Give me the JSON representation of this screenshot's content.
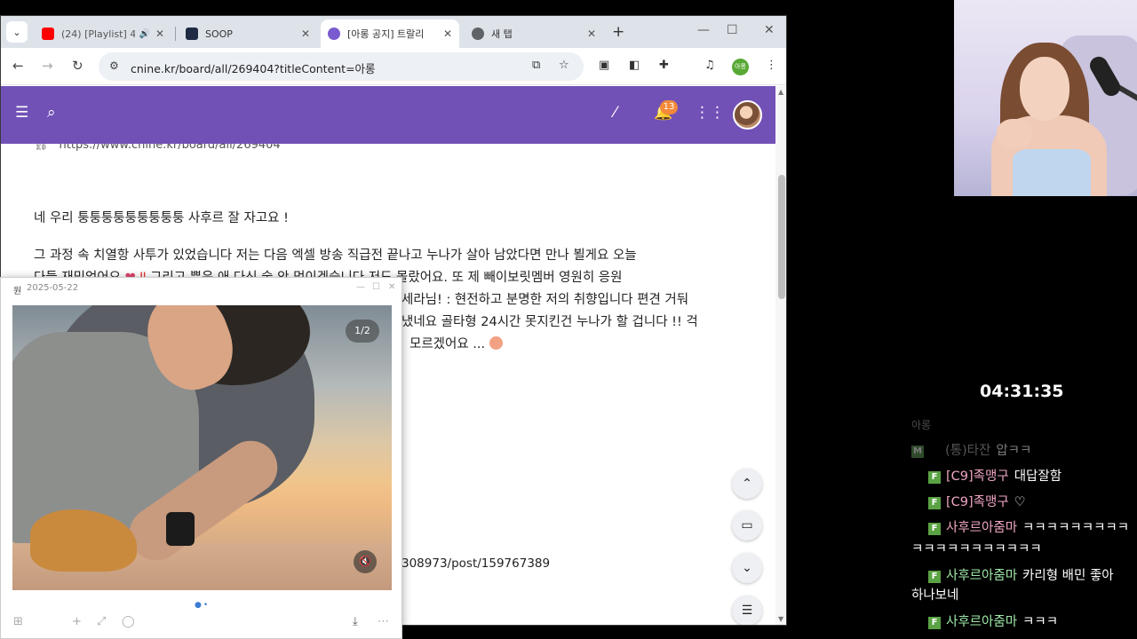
{
  "browser": {
    "tabs": [
      {
        "title": "(24) [Playlist] 4",
        "favicon": "youtube-icon",
        "color": "#ff0000",
        "audio": true
      },
      {
        "title": "SOOP",
        "favicon": "soop-icon",
        "color": "#1f2a44"
      },
      {
        "title": "[아롱 공지] 트랄리",
        "favicon": "cnine-icon",
        "color": "#7a5bd0",
        "active": true
      },
      {
        "title": "새 탭",
        "favicon": "chrome-icon",
        "color": "#5f6368"
      }
    ],
    "url": "cnine.kr/board/all/269404?titleContent=아롱",
    "profile_label": "아롱"
  },
  "site": {
    "accent": "#7251b7",
    "notification_count": "13",
    "post": {
      "link": "https://www.cnine.kr/board/all/269404",
      "paragraphs": [
        "네 우리 퉁퉁퉁퉁퉁퉁퉁퉁퉁 사후르 잘 자고요 !",
        "그 과정 속 치열항 사투가 있었습니다 저는 다음 엑셀 방송 직급전 끝나고 누나가 살아 남았다면 만나 뵐게요 오늘",
        "다들 재밌었어요",
        "그리고 뿐은 애 다신 술 안 먹이겠습니다 저도 몰랐어요. 또 제 빼이보릿멤버 영원히 응원",
        "세라님! : 현전하고 분명한 저의 취향입니다 편견 거둬",
        "냈네요 골타형 24시간 못지킨건 누나가 할 겁니다 !! 걱",
        "모르겠어요 ..."
      ],
      "partial_url": "308973/post/159767389"
    }
  },
  "popup": {
    "author": "원",
    "date": "2025-05-22",
    "pager": "1/2"
  },
  "stream": {
    "timer": "04:31:35",
    "chat_header": "아롱",
    "chat": [
      {
        "badge": "M",
        "nick": "(통)타잔",
        "msg": "압ㅋㅋ",
        "dim": true
      },
      {
        "badge": "F",
        "nick": "[C9]족맹구",
        "msg": "대답잘함",
        "color": "pink"
      },
      {
        "badge": "F",
        "nick": "[C9]족맹구",
        "msg": "♡",
        "color": "pink"
      },
      {
        "badge": "F",
        "nick": "사후르아줌마",
        "msg": "ㅋㅋㅋㅋㅋㅋㅋㅋㅋ",
        "cont": "ㅋㅋㅋㅋㅋㅋㅋㅋㅋㅋㅋ",
        "color": "pink"
      },
      {
        "badge": "F",
        "nick": "사후르아줌마",
        "msg": "카리형 배민 좋아",
        "cont": "하나보네",
        "color": "green"
      },
      {
        "badge": "F",
        "nick": "사후르아줌마",
        "msg": "ㅋㅋㅋ",
        "color": "green"
      }
    ]
  }
}
